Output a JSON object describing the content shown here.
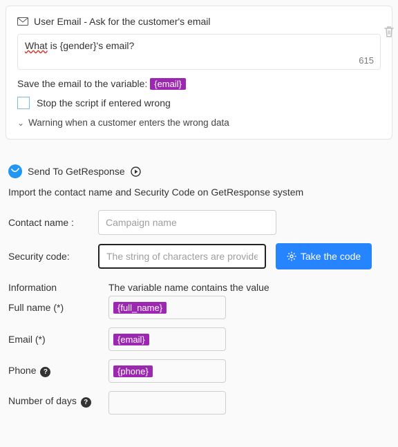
{
  "card1": {
    "title": "User Email - Ask for the customer's email",
    "textarea_value": "What is {gender}'s email?",
    "word_what": "What",
    "rest_text": " is {gender}'s email?",
    "char_count": "615",
    "save_prefix": "Save the email to the variable: ",
    "save_tag": "{email}",
    "stop_label": "Stop the script if entered wrong",
    "warning_label": "Warning when a customer enters the wrong data"
  },
  "card2": {
    "title": "Send To GetResponse",
    "import_desc": "Import the contact name and Security Code on GetResponse system",
    "contact_label": "Contact name :",
    "contact_placeholder": "Campaign name",
    "security_label": "Security code:",
    "security_placeholder": "The string of characters are provide o",
    "take_code_btn": "Take the code",
    "info_label": "Information",
    "info_heading": "The variable name contains the value",
    "fullname_label": "Full name (*)",
    "fullname_tag": "{full_name}",
    "email_label": "Email (*)",
    "email_tag": "{email}",
    "phone_label": "Phone",
    "phone_tag": "{phone}",
    "days_label": "Number of days"
  }
}
